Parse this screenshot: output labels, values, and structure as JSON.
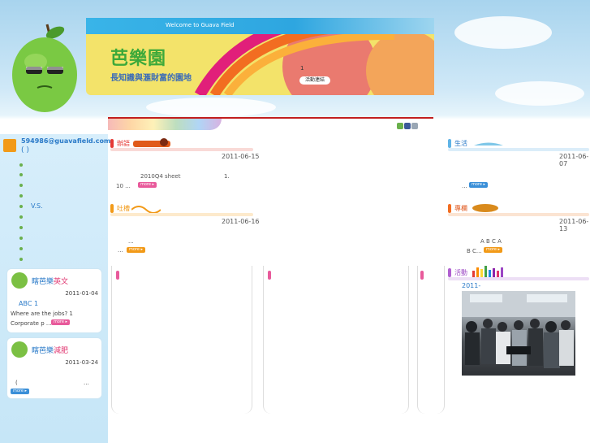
{
  "header": {
    "welcome": "Welcome to Guava Field",
    "site_name": "芭樂園",
    "tagline": "長知識與滙財富的園地",
    "banner_number": "1",
    "banner_button": "活動連結"
  },
  "sidebar": {
    "email": "594986@guavafield.com",
    "email_paren": "(            )",
    "vs_text": "V.S.",
    "cards": [
      {
        "title_a": "瞎芭樂",
        "title_b": "英文",
        "date": "2011-01-04",
        "line1": "ABC 1",
        "line2": "Where are the jobs? 1",
        "line3": "Corporate p ...",
        "more": "more ▸"
      },
      {
        "title_a": "瞎芭樂",
        "title_b": "減肥",
        "date": "2011-03-24",
        "line1": "(",
        "line2": "...",
        "more": "more ▸"
      }
    ]
  },
  "sections": {
    "s1": {
      "label": "辦語",
      "date": "2011-06-15",
      "line1": "2010Q4 sheet",
      "line1b": "1.",
      "line2": "10   ...",
      "more": "more ▸"
    },
    "s2": {
      "label": "吐槽",
      "date": "2011-06-16",
      "line1": "...",
      "line2": "...",
      "more": "more ▸"
    },
    "s3": {
      "label": "生活",
      "date": "2011-06-07",
      "line1": "...",
      "more": "more ▸"
    },
    "s4": {
      "label": "專欄",
      "date": "2011-06-13",
      "line1": "A                B   C                           A",
      "line2": "B  C...",
      "more": "more ▸"
    },
    "s5": {
      "label": "活動",
      "date": "2011-"
    }
  },
  "colors": {
    "accent_green": "#3da93a",
    "accent_blue": "#2a7ac8",
    "accent_pink": "#e0356f"
  }
}
